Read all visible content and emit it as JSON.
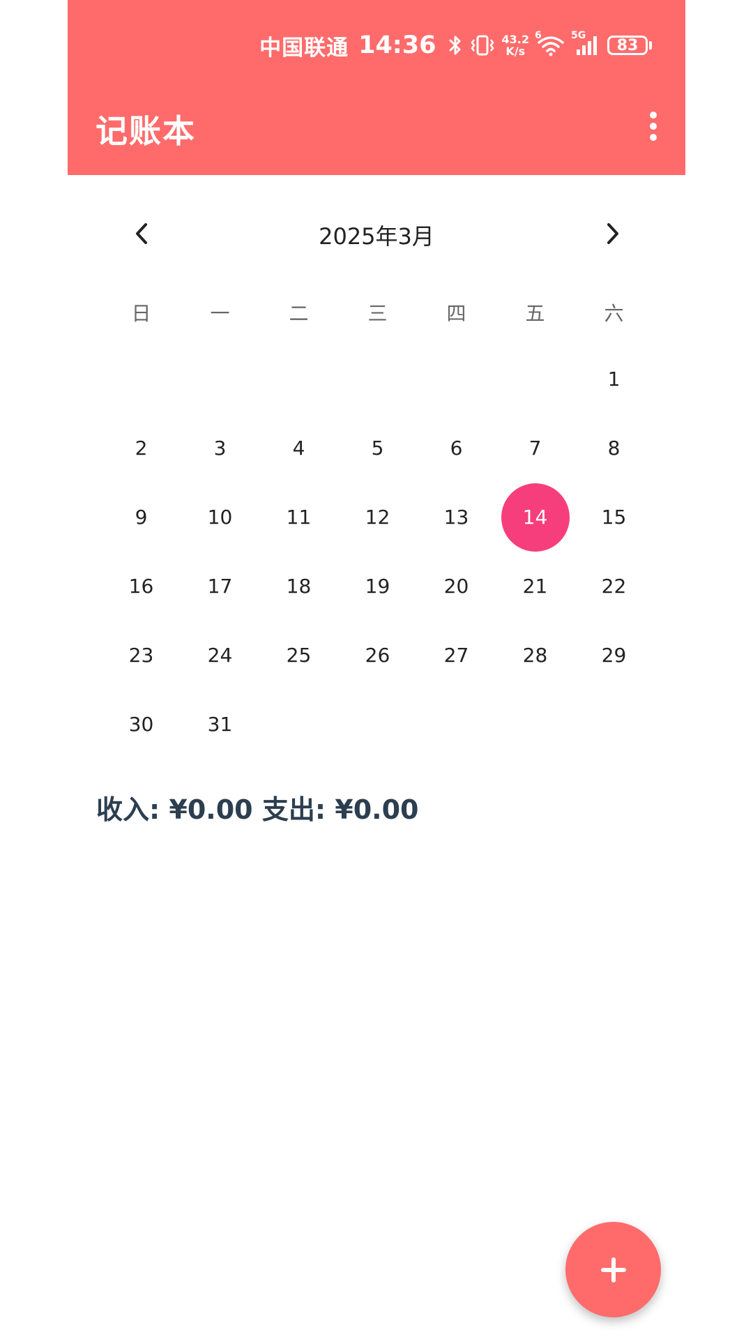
{
  "status_bar": {
    "carrier": "中国联通",
    "time": "14:36",
    "network_speed_value": "43.2",
    "network_speed_unit": "K/s",
    "wifi_label": "6",
    "cell_label": "5G",
    "battery": "83",
    "icons": [
      "bluetooth-icon",
      "vibrate-icon",
      "wifi-icon",
      "cellular-signal-icon",
      "battery-icon"
    ]
  },
  "app_bar": {
    "title": "记账本",
    "menu_icon": "more-vert-icon",
    "background_color": "#ff6b6b"
  },
  "calendar": {
    "month_title": "2025年3月",
    "prev_icon": "chevron-left-icon",
    "next_icon": "chevron-right-icon",
    "weekdays": [
      "日",
      "一",
      "二",
      "三",
      "四",
      "五",
      "六"
    ],
    "days": [
      "",
      "",
      "",
      "",
      "",
      "",
      "1",
      "2",
      "3",
      "4",
      "5",
      "6",
      "7",
      "8",
      "9",
      "10",
      "11",
      "12",
      "13",
      "14",
      "15",
      "16",
      "17",
      "18",
      "19",
      "20",
      "21",
      "22",
      "23",
      "24",
      "25",
      "26",
      "27",
      "28",
      "29",
      "30",
      "31"
    ],
    "selected_day": "14",
    "selected_color": "#f73e7c"
  },
  "summary": {
    "text": "收入: ¥0.00 支出: ¥0.00"
  },
  "fab": {
    "icon": "plus-icon",
    "color": "#ff6b6b"
  }
}
